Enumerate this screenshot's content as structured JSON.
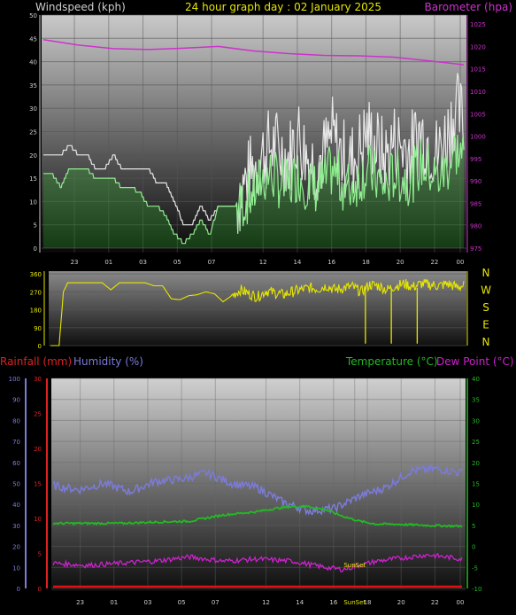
{
  "titles": {
    "wind": "Windspeed (kph)",
    "center": "24 hour graph day : 02 January 2025",
    "baro": "Barometer (hpa)",
    "rain": "Rainfall (mm)",
    "humidity": "Humidity (%)",
    "temperature": "Temperature (°C)",
    "dewpoint": "Dew Point (°C)"
  },
  "compass": [
    "N",
    "W",
    "S",
    "E",
    "N"
  ],
  "annotations": {
    "sunset": "SunSet",
    "sunset_axis": "SunSet"
  },
  "x_ticks": [
    "23",
    "01",
    "03",
    "05",
    "07",
    "12",
    "14",
    "16",
    "18",
    "20",
    "22",
    "00"
  ],
  "x_ticks_bottom": [
    "23",
    "01",
    "03",
    "05",
    "07",
    "12",
    "14",
    "16",
    "SunSet",
    "18",
    "20",
    "22",
    "00"
  ],
  "colors": {
    "wind_gust": "#e8e8e8",
    "wind_avg": "#90ee90",
    "wind_avg_fill": "#33cc33",
    "barometer": "#cc33cc",
    "direction": "#e6e600",
    "humidity": "#7b7bd9",
    "temperature": "#22bb22",
    "dewpoint": "#cc22cc",
    "rainfall": "#dd1111",
    "title_wind": "#cfcfcf",
    "title_center": "#e6e600",
    "title_baro": "#cc33cc",
    "title_rain": "#dd2222",
    "title_hum": "#7b7bd9",
    "title_temp": "#22bb22",
    "title_dew": "#cc22cc"
  },
  "chart_data": [
    {
      "type": "line",
      "name": "wind-baro",
      "y_left": {
        "label": "Windspeed (kph)",
        "ticks": [
          0,
          5,
          10,
          15,
          20,
          25,
          30,
          35,
          40,
          45,
          50
        ],
        "range": [
          0,
          50
        ]
      },
      "y_right": {
        "label": "Barometer (hpa)",
        "ticks": [
          975,
          980,
          985,
          990,
          995,
          1000,
          1005,
          1010,
          1015,
          1020,
          1025
        ],
        "range": [
          975,
          1027
        ]
      },
      "series": [
        {
          "key": "gust",
          "x": [
            0,
            1,
            2,
            3,
            4,
            5,
            6,
            7,
            8,
            9,
            10,
            11,
            12,
            13,
            14,
            15,
            16,
            17,
            18,
            19,
            20,
            21,
            22,
            23,
            24,
            25,
            26,
            27,
            28,
            29,
            30,
            31,
            32,
            33,
            34,
            35,
            36,
            37,
            38,
            39,
            40,
            41,
            42,
            43,
            44,
            45,
            46,
            47,
            48
          ],
          "values": [
            20,
            20,
            20,
            22,
            20,
            20,
            17,
            17,
            20,
            17,
            17,
            17,
            17,
            14,
            14,
            10,
            5,
            5,
            9,
            6,
            9,
            9,
            9,
            14,
            17,
            20,
            22,
            21,
            19,
            25,
            20,
            18,
            20,
            24,
            20,
            18,
            21,
            25,
            22,
            19,
            23,
            22,
            21,
            25,
            23,
            20,
            24,
            30,
            27
          ]
        },
        {
          "key": "avg",
          "x": [
            0,
            1,
            2,
            3,
            4,
            5,
            6,
            7,
            8,
            9,
            10,
            11,
            12,
            13,
            14,
            15,
            16,
            17,
            18,
            19,
            20,
            21,
            22,
            23,
            24,
            25,
            26,
            27,
            28,
            29,
            30,
            31,
            32,
            33,
            34,
            35,
            36,
            37,
            38,
            39,
            40,
            41,
            42,
            43,
            44,
            45,
            46,
            47,
            48
          ],
          "values": [
            16,
            16,
            13,
            17,
            17,
            17,
            15,
            15,
            15,
            13,
            13,
            12,
            9,
            9,
            7,
            3,
            1,
            3,
            6,
            3,
            9,
            9,
            9,
            10,
            12,
            15,
            16,
            14,
            13,
            16,
            14,
            13,
            14,
            17,
            14,
            13,
            15,
            17,
            15,
            13,
            16,
            15,
            15,
            18,
            17,
            15,
            17,
            21,
            20
          ]
        },
        {
          "key": "barometer",
          "x": [
            0,
            4,
            8,
            12,
            16,
            20,
            24,
            28,
            32,
            36,
            40,
            44,
            48
          ],
          "values": [
            1021.5,
            1020.3,
            1019.5,
            1019.3,
            1019.6,
            1020.0,
            1019.0,
            1018.4,
            1018.0,
            1017.9,
            1017.6,
            1016.8,
            1015.9
          ]
        }
      ]
    },
    {
      "type": "line",
      "name": "wind-direction",
      "y_ticks": [
        0,
        90,
        180,
        270,
        360
      ],
      "series": [
        {
          "key": "direction",
          "x": [
            0,
            1,
            1.5,
            2,
            5,
            6,
            7,
            8,
            9,
            10,
            11,
            12,
            13,
            14,
            15,
            16,
            17,
            18,
            19,
            20,
            21,
            22,
            23,
            24,
            25,
            26,
            27,
            28,
            29,
            30,
            31,
            32,
            33,
            34,
            35,
            36,
            37,
            38,
            39,
            40,
            41,
            42,
            43,
            44,
            45,
            46,
            47,
            48
          ],
          "values": [
            0,
            0,
            270,
            315,
            315,
            315,
            280,
            315,
            315,
            315,
            315,
            300,
            300,
            235,
            230,
            250,
            255,
            270,
            260,
            220,
            250,
            280,
            260,
            245,
            275,
            265,
            255,
            270,
            280,
            290,
            285,
            300,
            280,
            290,
            295,
            270,
            305,
            300,
            280,
            300,
            310,
            295,
            310,
            305,
            300,
            310,
            295,
            300
          ]
        }
      ]
    },
    {
      "type": "line",
      "name": "temp-hum",
      "y_left_hum": {
        "label": "Humidity (%)",
        "ticks": [
          0,
          10,
          20,
          30,
          40,
          50,
          60,
          70,
          80,
          90,
          100
        ]
      },
      "y_left_rain": {
        "label": "Rainfall (mm)",
        "ticks": [
          0,
          5,
          10,
          15,
          20,
          25,
          30
        ]
      },
      "y_right": {
        "label": "Temperature (°C)",
        "ticks": [
          -10,
          -5,
          0,
          5,
          10,
          15,
          20,
          25,
          30,
          35,
          40
        ]
      },
      "series": [
        {
          "key": "humidity",
          "x": [
            0,
            3,
            6,
            9,
            12,
            15,
            18,
            21,
            24,
            27,
            30,
            33,
            36,
            39,
            42,
            45,
            48
          ],
          "values": [
            49,
            47,
            50,
            46,
            51,
            52,
            55,
            50,
            48,
            41,
            37,
            38,
            44,
            48,
            56,
            57,
            55
          ]
        },
        {
          "key": "temperature",
          "x": [
            0,
            4,
            8,
            12,
            16,
            20,
            24,
            26,
            28,
            30,
            32,
            34,
            36,
            38,
            40,
            44,
            48
          ],
          "values": [
            5.5,
            5.5,
            5.5,
            5.8,
            6.0,
            7.5,
            8.3,
            9.0,
            9.5,
            9.5,
            8.7,
            7.2,
            6.0,
            5.3,
            5.3,
            5.0,
            4.8
          ]
        },
        {
          "key": "dewpoint",
          "x": [
            0,
            4,
            8,
            12,
            16,
            20,
            24,
            28,
            32,
            34,
            36,
            38,
            40,
            44,
            48
          ],
          "values": [
            -4.0,
            -4.5,
            -4.0,
            -3.5,
            -2.5,
            -3.5,
            -3.0,
            -3.5,
            -5.0,
            -5.5,
            -4.5,
            -3.5,
            -3.0,
            -2.0,
            -3.0
          ]
        },
        {
          "key": "rainfall",
          "x": [
            0,
            48
          ],
          "values": [
            0,
            0
          ]
        }
      ]
    }
  ]
}
